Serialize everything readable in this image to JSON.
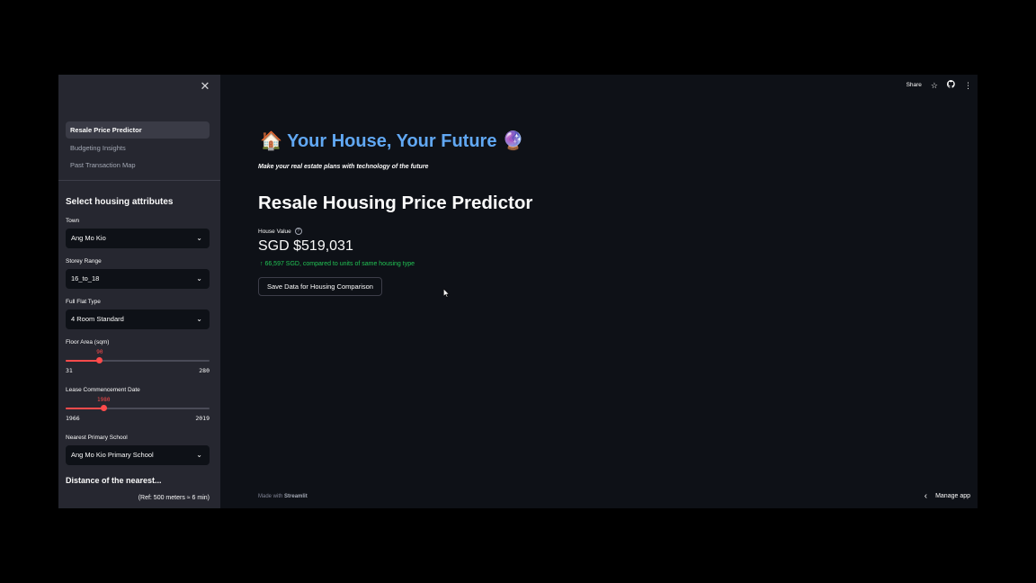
{
  "sidebar": {
    "close_icon": "close-icon",
    "nav": [
      {
        "label": "Resale Price Predictor",
        "active": true
      },
      {
        "label": "Budgeting Insights",
        "active": false
      },
      {
        "label": "Past Transaction Map",
        "active": false
      }
    ],
    "section_heading": "Select housing attributes",
    "town": {
      "label": "Town",
      "value": "Ang Mo Kio"
    },
    "storey": {
      "label": "Storey Range",
      "value": "16_to_18"
    },
    "flat_type": {
      "label": "Full Flat Type",
      "value": "4 Room Standard"
    },
    "floor_area": {
      "label": "Floor Area (sqm)",
      "value": "90",
      "min": "31",
      "max": "280",
      "fraction": 0.237
    },
    "lease": {
      "label": "Lease Commencement Date",
      "value": "1980",
      "min": "1966",
      "max": "2019",
      "fraction": 0.264
    },
    "school": {
      "label": "Nearest Primary School",
      "value": "Ang Mo Kio Primary School"
    },
    "distance_heading": "Distance of the nearest...",
    "ref_note": "(Ref: 500 meters ≈ 6 min)"
  },
  "toolbar": {
    "share": "Share",
    "star_icon": "star-icon",
    "github_icon": "github-icon",
    "menu_icon": "more-vertical-icon"
  },
  "main": {
    "hero_title": "🏠 Your House, Your Future 🔮",
    "subtitle": "Make your real estate plans with technology of the future",
    "page_title": "Resale Housing Price Predictor",
    "metric": {
      "label": "House Value",
      "value": "SGD $519,031",
      "delta": "↑ 66,597 SGD, compared to units of same housing type"
    },
    "save_button": "Save Data for Housing Comparison"
  },
  "footer": {
    "made_with": "Made with",
    "brand": "Streamlit",
    "manage_app": "Manage app"
  },
  "colors": {
    "accent": "#ff4b4b",
    "hero": "#61a8f3",
    "delta": "#21c354",
    "background": "#0e1117",
    "sidebar": "#262730"
  }
}
